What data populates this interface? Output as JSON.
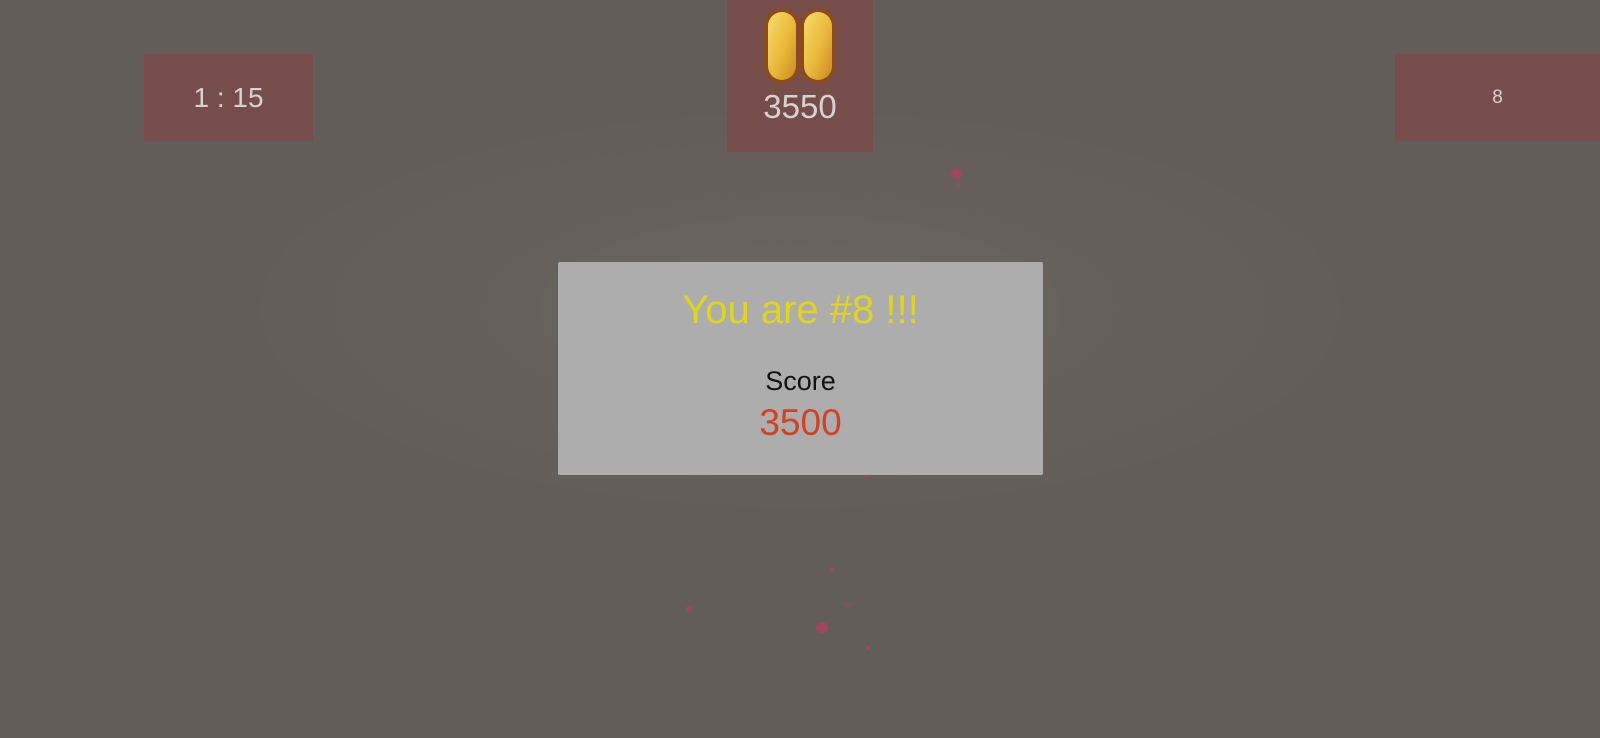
{
  "hud": {
    "timer": "1 : 15",
    "score": "3550",
    "rank": "8"
  },
  "result_panel": {
    "title": "You are #8 !!!",
    "score_label": "Score",
    "score_value": "3500"
  },
  "icons": {
    "pause": "pause-icon"
  },
  "colors": {
    "background": "#625d58",
    "hud_box": "#764d4a",
    "hud_text": "#d6d2cf",
    "panel": "#adadad",
    "title": "#e3d51a",
    "score_value": "#d24120",
    "pause_gold": "#e9b93a"
  }
}
